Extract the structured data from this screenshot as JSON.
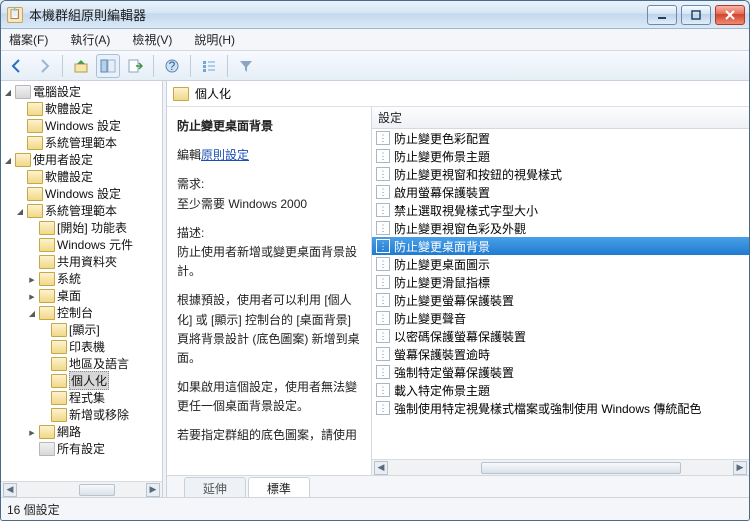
{
  "window": {
    "title": "本機群組原則編輯器"
  },
  "menu": {
    "file": "檔案(F)",
    "action": "執行(A)",
    "view": "檢視(V)",
    "help": "說明(H)"
  },
  "toolbar": {
    "back": "back",
    "fwd": "forward",
    "up": "up",
    "props": "properties",
    "refresh": "refresh",
    "export": "export",
    "help": "help",
    "listview": "listview",
    "filter": "filter"
  },
  "tree": {
    "root": "電腦設定",
    "items": [
      {
        "indent": 1,
        "twist": "none",
        "label": "軟體設定"
      },
      {
        "indent": 1,
        "twist": "none",
        "label": "Windows 設定"
      },
      {
        "indent": 1,
        "twist": "none",
        "label": "系統管理範本"
      },
      {
        "indent": 0,
        "twist": "open",
        "label": "使用者設定"
      },
      {
        "indent": 1,
        "twist": "none",
        "label": "軟體設定"
      },
      {
        "indent": 1,
        "twist": "none",
        "label": "Windows 設定"
      },
      {
        "indent": 1,
        "twist": "open",
        "label": "系統管理範本"
      },
      {
        "indent": 2,
        "twist": "none",
        "label": "[開始] 功能表"
      },
      {
        "indent": 2,
        "twist": "none",
        "label": "Windows 元件"
      },
      {
        "indent": 2,
        "twist": "none",
        "label": "共用資料夾"
      },
      {
        "indent": 2,
        "twist": "closed",
        "label": "系統"
      },
      {
        "indent": 2,
        "twist": "closed",
        "label": "桌面"
      },
      {
        "indent": 2,
        "twist": "open",
        "label": "控制台"
      },
      {
        "indent": 3,
        "twist": "none",
        "label": "[顯示]"
      },
      {
        "indent": 3,
        "twist": "none",
        "label": "印表機"
      },
      {
        "indent": 3,
        "twist": "none",
        "label": "地區及語言"
      },
      {
        "indent": 3,
        "twist": "none",
        "label": "個人化",
        "selected": true
      },
      {
        "indent": 3,
        "twist": "none",
        "label": "程式集"
      },
      {
        "indent": 3,
        "twist": "none",
        "label": "新增或移除"
      },
      {
        "indent": 2,
        "twist": "closed",
        "label": "網路"
      },
      {
        "indent": 2,
        "twist": "none",
        "label": "所有設定",
        "gray": true
      }
    ]
  },
  "main": {
    "header": "個人化",
    "detail": {
      "title": "防止變更桌面背景",
      "edit_prefix": "編輯",
      "edit_link": "原則設定",
      "req_label": "需求:",
      "req_value": "至少需要 Windows 2000",
      "desc_label": "描述:",
      "desc_1": "防止使用者新增或變更桌面背景設計。",
      "desc_2": "根據預設，使用者可以利用 [個人化] 或 [顯示] 控制台的 [桌面背景] 頁將背景設計 (底色圖案) 新增到桌面。",
      "desc_3": "如果啟用這個設定，使用者無法變更任一個桌面背景設定。",
      "desc_4": "若要指定群組的底色圖案，請使用"
    },
    "column_header": "設定",
    "rows": [
      "防止變更色彩配置",
      "防止變更佈景主題",
      "防止變更視窗和按鈕的視覺樣式",
      "啟用螢幕保護裝置",
      "禁止選取視覺樣式字型大小",
      "防止變更視窗色彩及外觀",
      "防止變更桌面背景",
      "防止變更桌面圖示",
      "防止變更滑鼠指標",
      "防止變更螢幕保護裝置",
      "防止變更聲音",
      "以密碼保護螢幕保護裝置",
      "螢幕保護裝置逾時",
      "強制特定螢幕保護裝置",
      "載入特定佈景主題",
      "強制使用特定視覺樣式檔案或強制使用 Windows 傳統配色"
    ],
    "selected_index": 6,
    "tabs": {
      "extended": "延伸",
      "standard": "標準"
    }
  },
  "status": {
    "count": "16 個設定"
  }
}
